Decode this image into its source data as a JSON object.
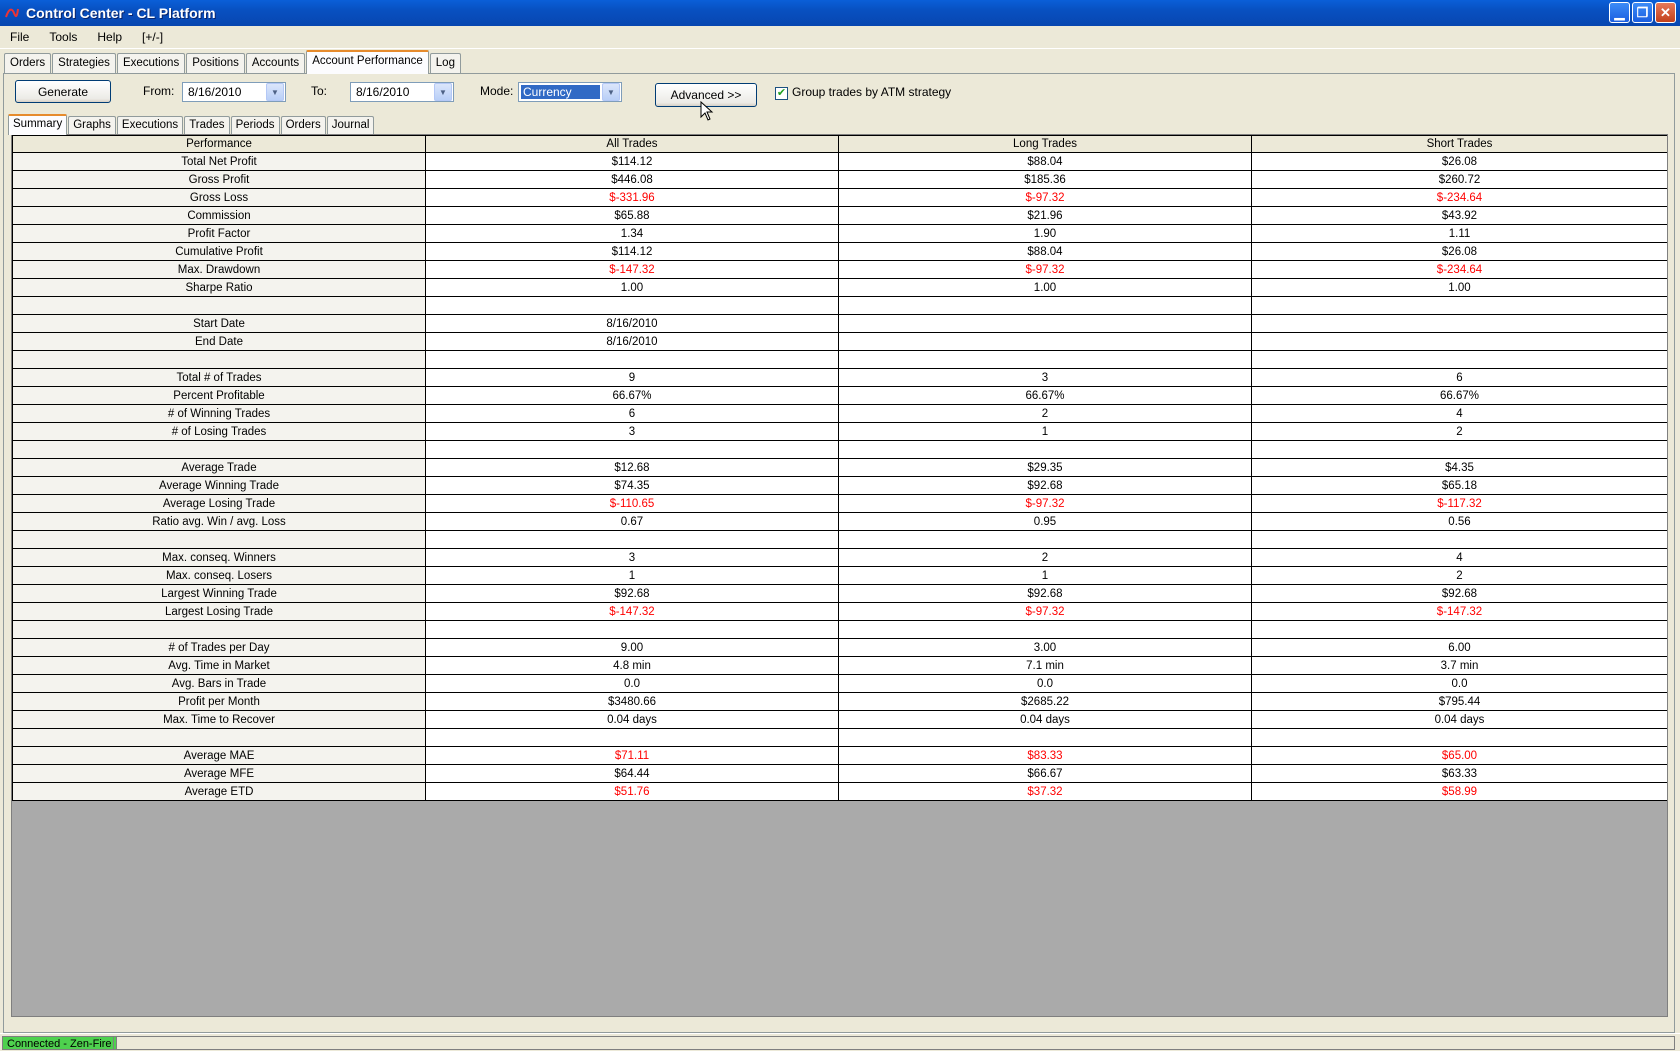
{
  "window": {
    "title": "Control Center - CL Platform"
  },
  "menu": [
    "File",
    "Tools",
    "Help",
    "[+/-]"
  ],
  "main_tabs": {
    "items": [
      "Orders",
      "Strategies",
      "Executions",
      "Positions",
      "Accounts",
      "Account Performance",
      "Log"
    ],
    "active": 5
  },
  "toolbar": {
    "generate_label": "Generate",
    "from_label": "From:",
    "from_value": "8/16/2010",
    "to_label": "To:",
    "to_value": "8/16/2010",
    "mode_label": "Mode:",
    "mode_value": "Currency",
    "advanced_label": "Advanced >>",
    "group_label": "Group trades by ATM strategy",
    "group_checked": true
  },
  "sub_tabs": {
    "items": [
      "Summary",
      "Graphs",
      "Executions",
      "Trades",
      "Periods",
      "Orders",
      "Journal"
    ],
    "active": 0
  },
  "table": {
    "headers": [
      "Performance",
      "All Trades",
      "Long Trades",
      "Short Trades"
    ],
    "rows": [
      [
        "Total Net Profit",
        "$114.12",
        "$88.04",
        "$26.08"
      ],
      [
        "Gross Profit",
        "$446.08",
        "$185.36",
        "$260.72"
      ],
      [
        "Gross Loss",
        "$-331.96",
        "$-97.32",
        "$-234.64"
      ],
      [
        "Commission",
        "$65.88",
        "$21.96",
        "$43.92"
      ],
      [
        "Profit Factor",
        "1.34",
        "1.90",
        "1.11"
      ],
      [
        "Cumulative Profit",
        "$114.12",
        "$88.04",
        "$26.08"
      ],
      [
        "Max. Drawdown",
        "$-147.32",
        "$-97.32",
        "$-234.64"
      ],
      [
        "Sharpe Ratio",
        "1.00",
        "1.00",
        "1.00"
      ],
      [
        "",
        "",
        "",
        ""
      ],
      [
        "Start Date",
        "8/16/2010",
        "",
        ""
      ],
      [
        "End Date",
        "8/16/2010",
        "",
        ""
      ],
      [
        "",
        "",
        "",
        ""
      ],
      [
        "Total # of Trades",
        "9",
        "3",
        "6"
      ],
      [
        "Percent Profitable",
        "66.67%",
        "66.67%",
        "66.67%"
      ],
      [
        "# of Winning Trades",
        "6",
        "2",
        "4"
      ],
      [
        "# of Losing Trades",
        "3",
        "1",
        "2"
      ],
      [
        "",
        "",
        "",
        ""
      ],
      [
        "Average Trade",
        "$12.68",
        "$29.35",
        "$4.35"
      ],
      [
        "Average Winning Trade",
        "$74.35",
        "$92.68",
        "$65.18"
      ],
      [
        "Average Losing Trade",
        "$-110.65",
        "$-97.32",
        "$-117.32"
      ],
      [
        "Ratio avg. Win / avg. Loss",
        "0.67",
        "0.95",
        "0.56"
      ],
      [
        "",
        "",
        "",
        ""
      ],
      [
        "Max. conseq. Winners",
        "3",
        "2",
        "4"
      ],
      [
        "Max. conseq. Losers",
        "1",
        "1",
        "2"
      ],
      [
        "Largest Winning Trade",
        "$92.68",
        "$92.68",
        "$92.68"
      ],
      [
        "Largest Losing Trade",
        "$-147.32",
        "$-97.32",
        "$-147.32"
      ],
      [
        "",
        "",
        "",
        ""
      ],
      [
        "# of Trades per Day",
        "9.00",
        "3.00",
        "6.00"
      ],
      [
        "Avg. Time in Market",
        "4.8 min",
        "7.1 min",
        "3.7 min"
      ],
      [
        "Avg. Bars in Trade",
        "0.0",
        "0.0",
        "0.0"
      ],
      [
        "Profit per Month",
        "$3480.66",
        "$2685.22",
        "$795.44"
      ],
      [
        "Max. Time to Recover",
        "0.04 days",
        "0.04 days",
        "0.04 days"
      ],
      [
        "",
        "",
        "",
        ""
      ],
      [
        "Average MAE",
        "$71.11",
        "$83.33",
        "$65.00"
      ],
      [
        "Average MFE",
        "$64.44",
        "$66.67",
        "$63.33"
      ],
      [
        "Average ETD",
        "$51.76",
        "$37.32",
        "$58.99"
      ]
    ],
    "red_rows": [
      "Gross Loss",
      "Max. Drawdown",
      "Average Losing Trade",
      "Largest Losing Trade",
      "Average MAE",
      "Average ETD"
    ]
  },
  "status": {
    "connection": "Connected - Zen-Fire"
  },
  "colors": {
    "titlebar": "#0a5fd8",
    "negative": "#ff0000",
    "connected": "#4ed14e",
    "grid_empty": "#aaaaaa",
    "active_tab_accent": "#e68b2c"
  }
}
